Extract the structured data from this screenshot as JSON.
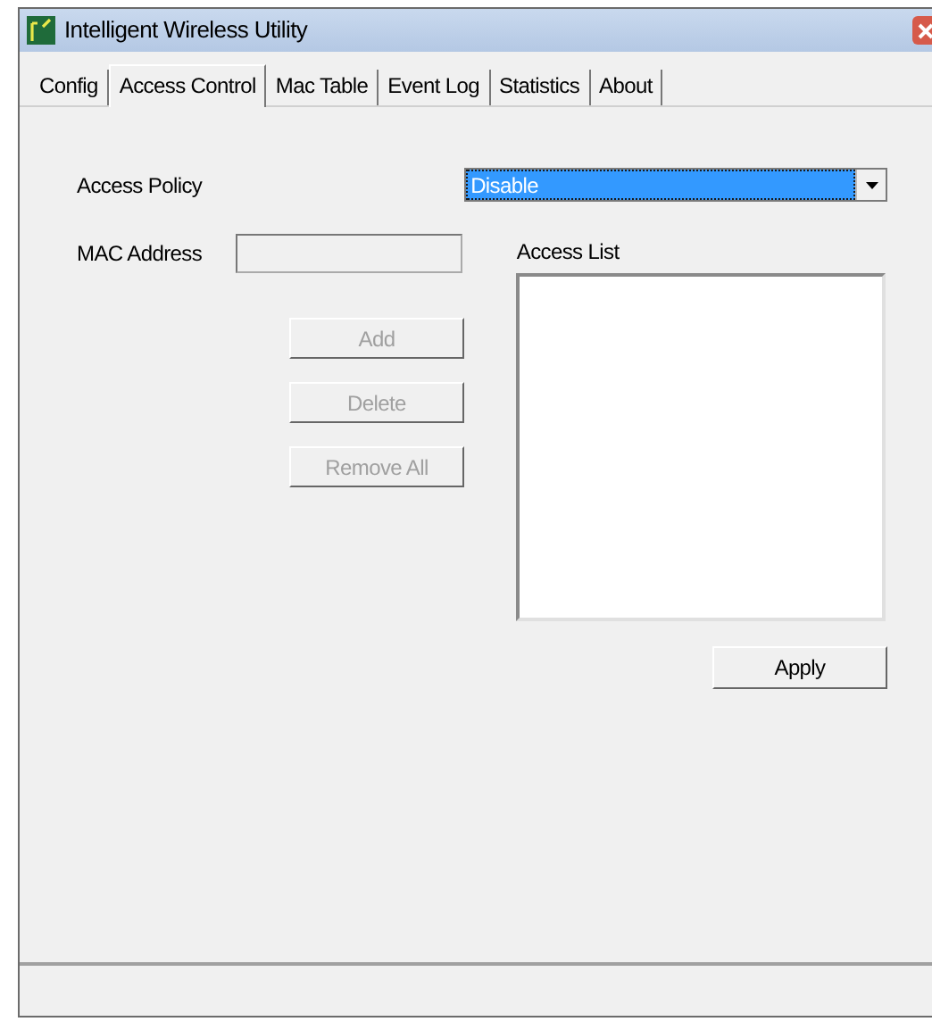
{
  "window": {
    "title": "Intelligent Wireless Utility"
  },
  "tabs": [
    {
      "label": "Config",
      "selected": false
    },
    {
      "label": "Access Control",
      "selected": true
    },
    {
      "label": "Mac Table",
      "selected": false
    },
    {
      "label": "Event Log",
      "selected": false
    },
    {
      "label": "Statistics",
      "selected": false
    },
    {
      "label": "About",
      "selected": false
    }
  ],
  "access_policy": {
    "label": "Access Policy",
    "value": "Disable"
  },
  "mac_address": {
    "label": "MAC Address"
  },
  "buttons": [
    {
      "label": "Add",
      "disabled": true
    },
    {
      "label": "Delete",
      "disabled": true
    },
    {
      "label": "Remove All",
      "disabled": true
    }
  ],
  "access_list": {
    "label": "Access List"
  },
  "apply_button": {
    "label": "Apply",
    "disabled": false
  }
}
